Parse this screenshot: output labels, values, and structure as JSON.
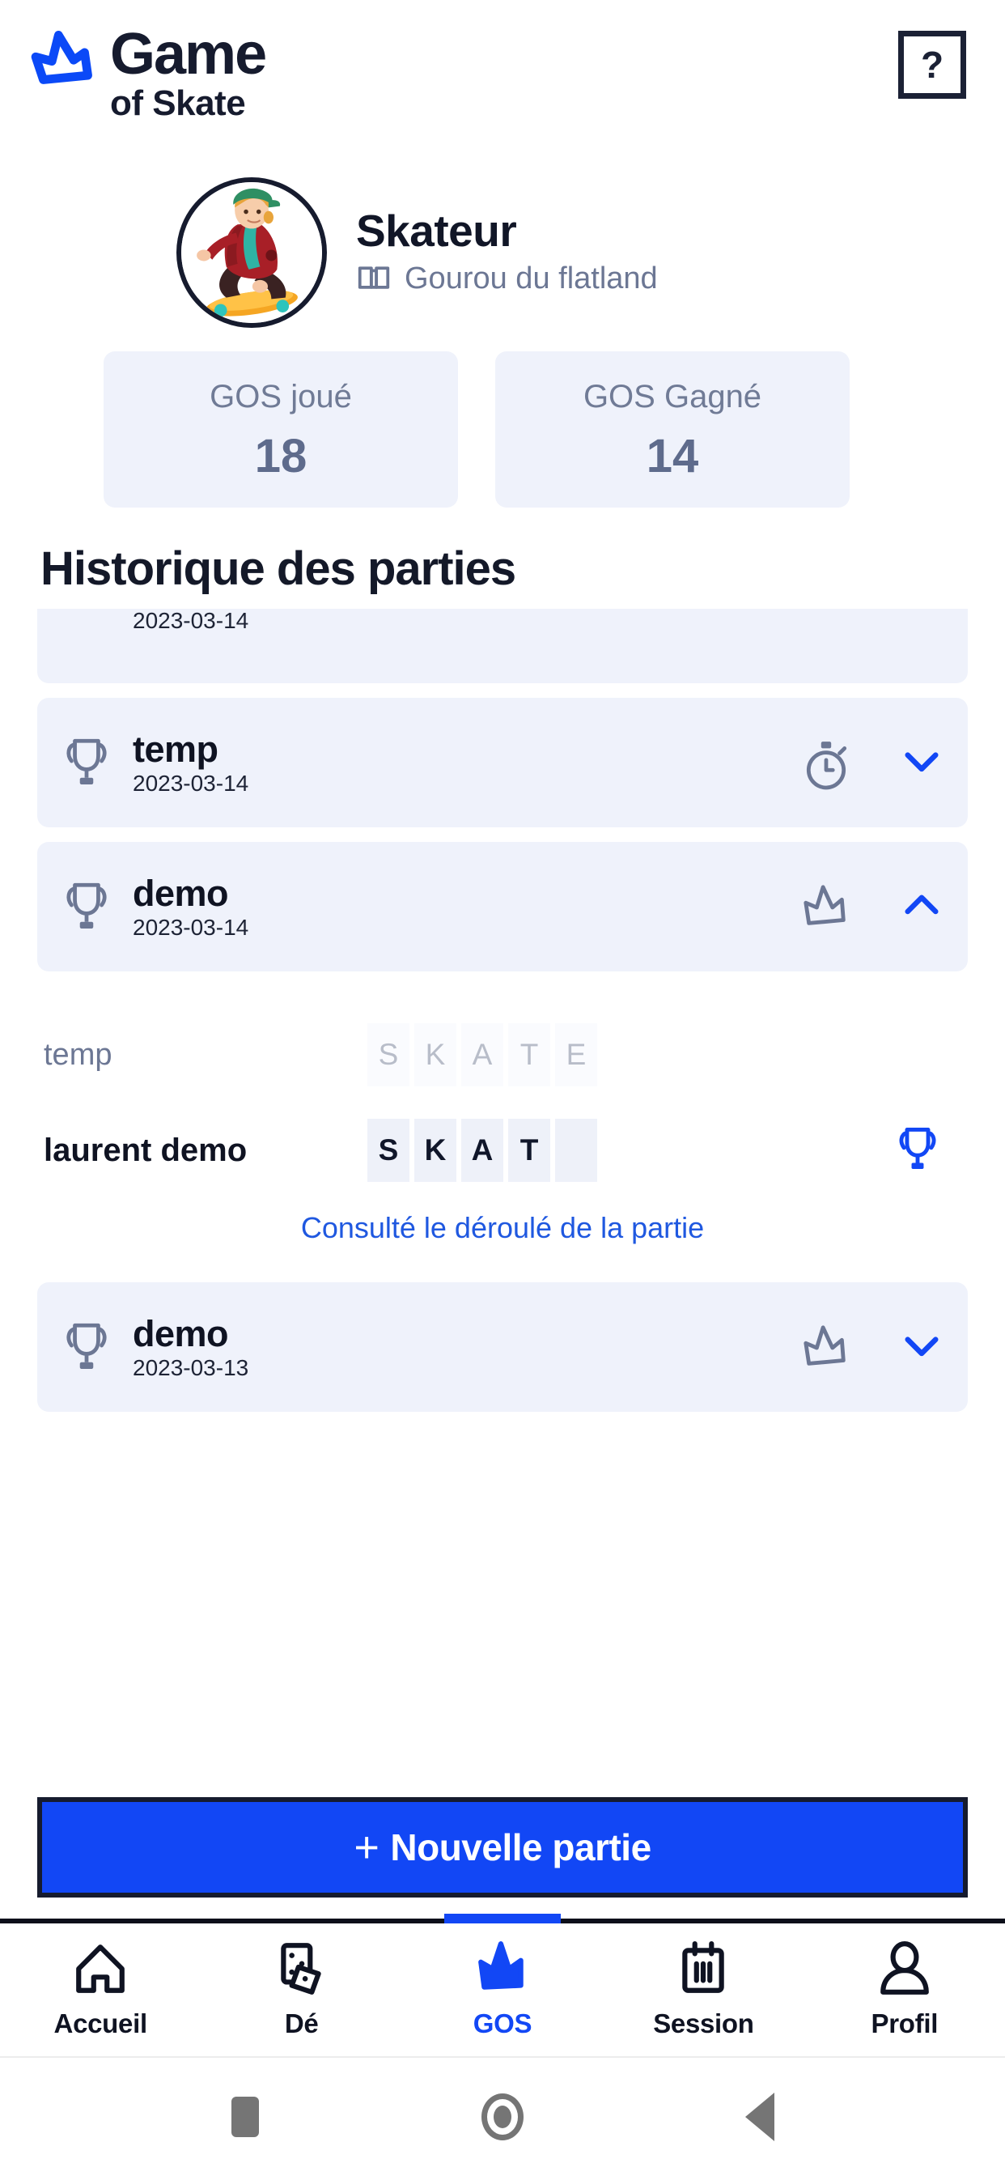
{
  "header": {
    "brand_line1": "Game",
    "brand_line2": "of Skate",
    "help_label": "?",
    "logo_icon": "crown-icon"
  },
  "profile": {
    "name": "Skateur",
    "rank": "Gourou du flatland",
    "rank_icon": "badge-icon",
    "avatar_icon": "skater-avatar"
  },
  "stats": [
    {
      "label": "GOS joué",
      "value": "18"
    },
    {
      "label": "GOS Gagné",
      "value": "14"
    }
  ],
  "history": {
    "title": "Historique des parties",
    "detail_link": "Consulté le déroulé de la partie",
    "games": [
      {
        "name": "temp",
        "date": "2023-03-14",
        "type_icon": "stopwatch-icon",
        "chevron": "chevron-down-icon",
        "expanded": false
      },
      {
        "name": "demo",
        "date": "2023-03-14",
        "type_icon": "crown-icon",
        "chevron": "chevron-up-icon",
        "expanded": true,
        "players": [
          {
            "name": "temp",
            "letters": [
              "S",
              "K",
              "A",
              "T",
              "E"
            ],
            "filled": 0,
            "winner": false
          },
          {
            "name": "laurent demo",
            "letters": [
              "S",
              "K",
              "A",
              "T",
              ""
            ],
            "filled": 4,
            "winner": true
          }
        ]
      },
      {
        "name": "demo",
        "date": "2023-03-13",
        "type_icon": "crown-icon",
        "chevron": "chevron-down-icon",
        "expanded": false
      }
    ]
  },
  "new_game": {
    "plus": "+",
    "label": "Nouvelle partie"
  },
  "bottom_nav": {
    "items": [
      {
        "label": "Accueil",
        "icon": "home-icon",
        "active": false
      },
      {
        "label": "Dé",
        "icon": "dice-icon",
        "active": false
      },
      {
        "label": "GOS",
        "icon": "crown-icon",
        "active": true
      },
      {
        "label": "Session",
        "icon": "calendar-icon",
        "active": false
      },
      {
        "label": "Profil",
        "icon": "person-icon",
        "active": false
      }
    ]
  },
  "colors": {
    "accent": "#1247f5",
    "ink": "#161b2e",
    "card_bg": "#eff2fb",
    "muted": "#6c7794"
  }
}
